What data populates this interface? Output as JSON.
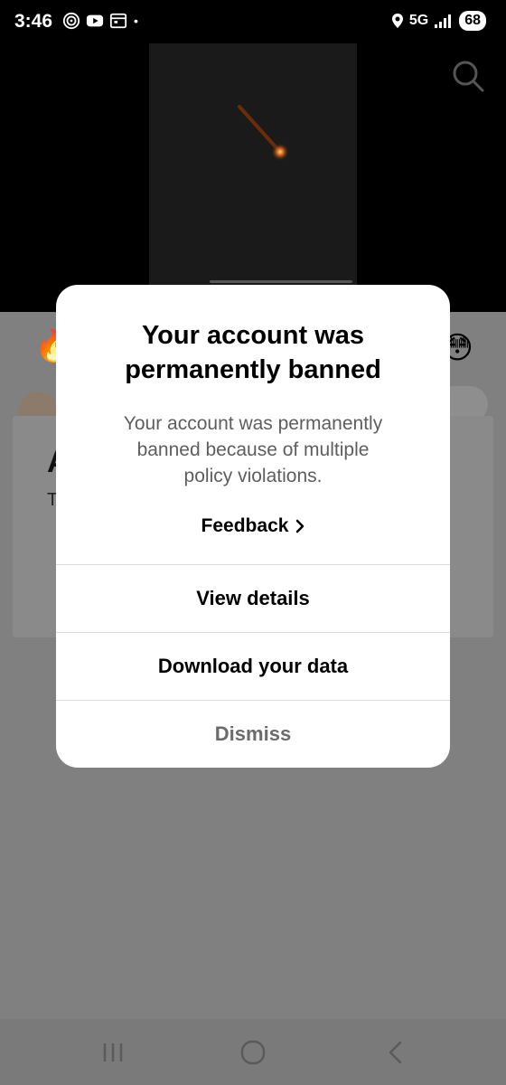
{
  "status_bar": {
    "time": "3:46",
    "network": "5G",
    "battery": "68",
    "icons_left": [
      "fingerprint-icon",
      "youtube-icon",
      "calendar-icon",
      "dot-icon"
    ],
    "icons_right": [
      "location-icon",
      "signal-icon"
    ]
  },
  "modal": {
    "title": "Your account was\npermanently banned",
    "message": "Your account was permanently\nbanned because of multiple\npolicy violations.",
    "feedback_label": "Feedback",
    "view_details_label": "View details",
    "download_label": "Download your data",
    "dismiss_label": "Dismiss"
  },
  "background": {
    "card_letter": "A",
    "card_letter2": "T"
  },
  "colors": {
    "overlay": "#7f7f7f",
    "modal_bg": "#ffffff",
    "message_text": "#5e5e5e",
    "dismiss_text": "#6b6b6b"
  }
}
